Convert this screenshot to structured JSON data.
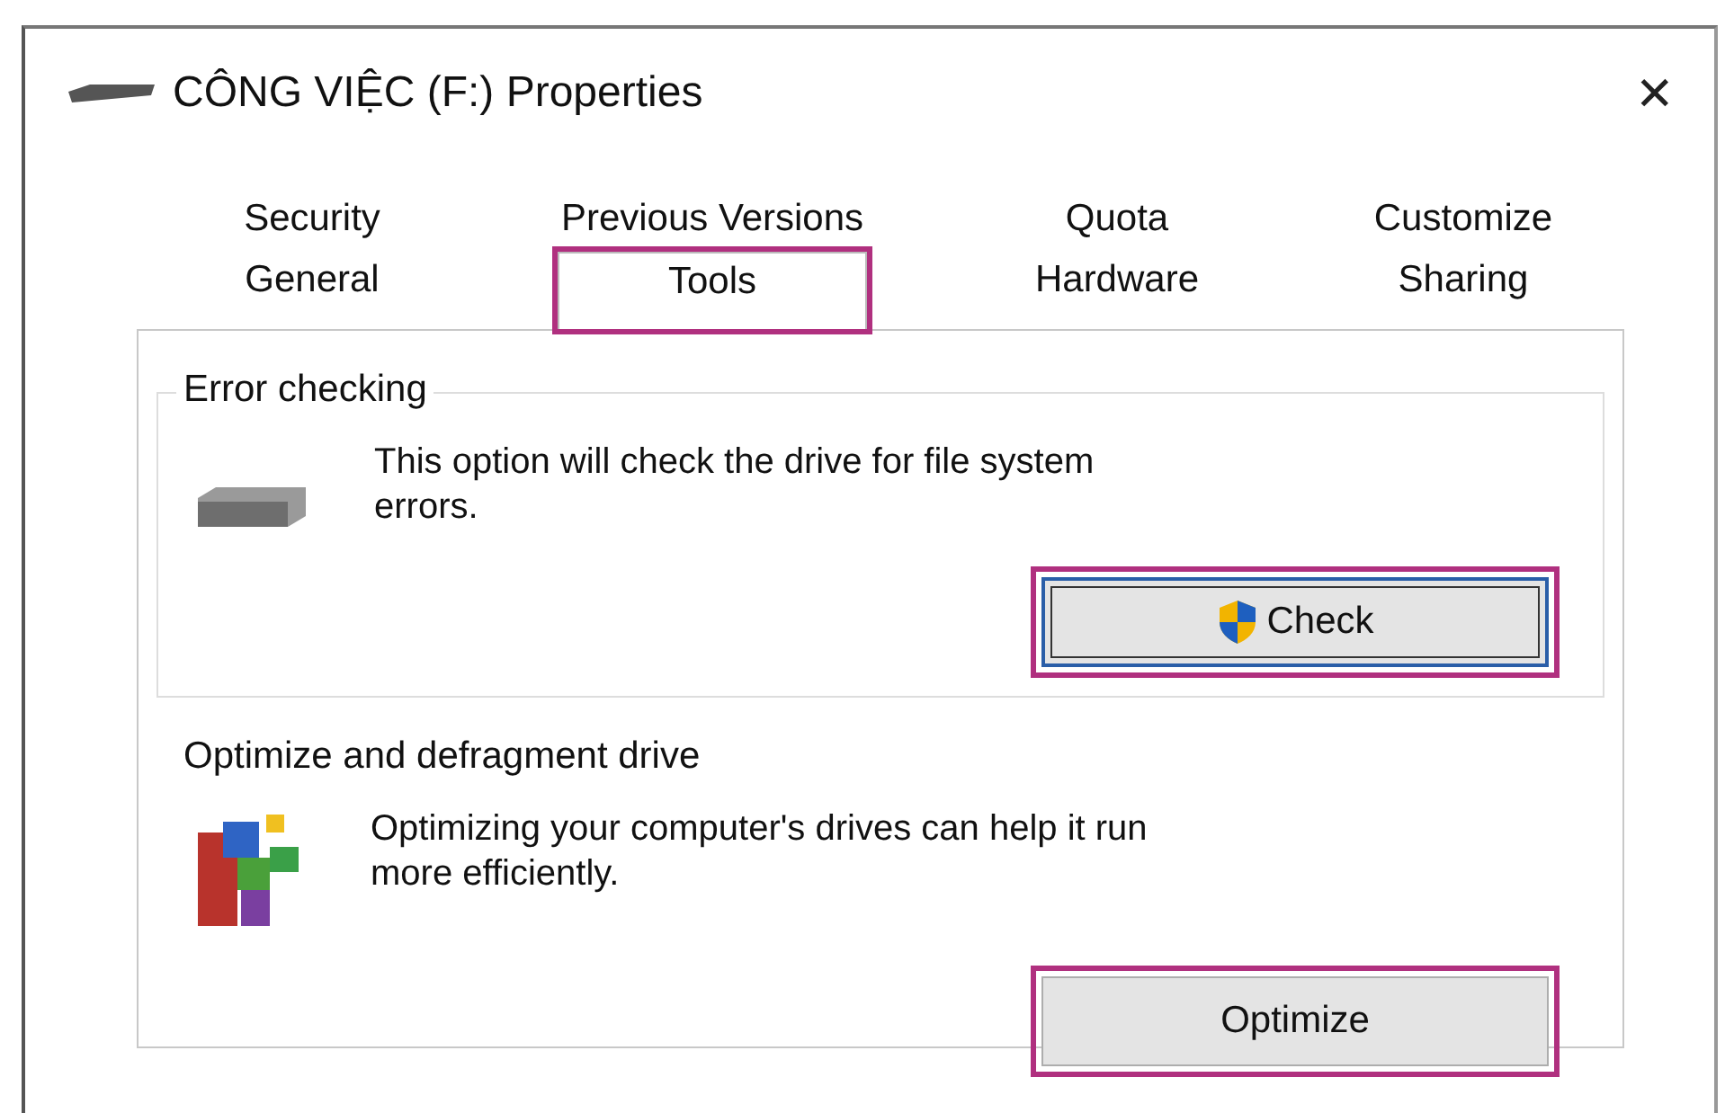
{
  "window": {
    "title": "CÔNG VIỆC (F:) Properties",
    "close": "✕"
  },
  "tab_rows": [
    {
      "tabs": [
        {
          "label": "Security",
          "selected": false,
          "highlighted": false
        },
        {
          "label": "Previous Versions",
          "selected": false,
          "highlighted": false
        },
        {
          "label": "Quota",
          "selected": false,
          "highlighted": false
        },
        {
          "label": "Customize",
          "selected": false,
          "highlighted": false
        }
      ]
    },
    {
      "tabs": [
        {
          "label": "General",
          "selected": false,
          "highlighted": false
        },
        {
          "label": "Tools",
          "selected": true,
          "highlighted": true
        },
        {
          "label": "Hardware",
          "selected": false,
          "highlighted": false
        },
        {
          "label": "Sharing",
          "selected": false,
          "highlighted": false
        }
      ]
    }
  ],
  "groups": [
    {
      "kind": "check",
      "title": "Error checking",
      "description": "This option will check the drive for file system errors.",
      "button": {
        "label": "Check",
        "focused": true,
        "highlighted": true
      }
    },
    {
      "kind": "optimize",
      "title": "Optimize and defragment drive",
      "description": "Optimizing your computer's drives can help it run more efficiently.",
      "button": {
        "label": "Optimize",
        "focused": false,
        "highlighted": true
      }
    }
  ]
}
